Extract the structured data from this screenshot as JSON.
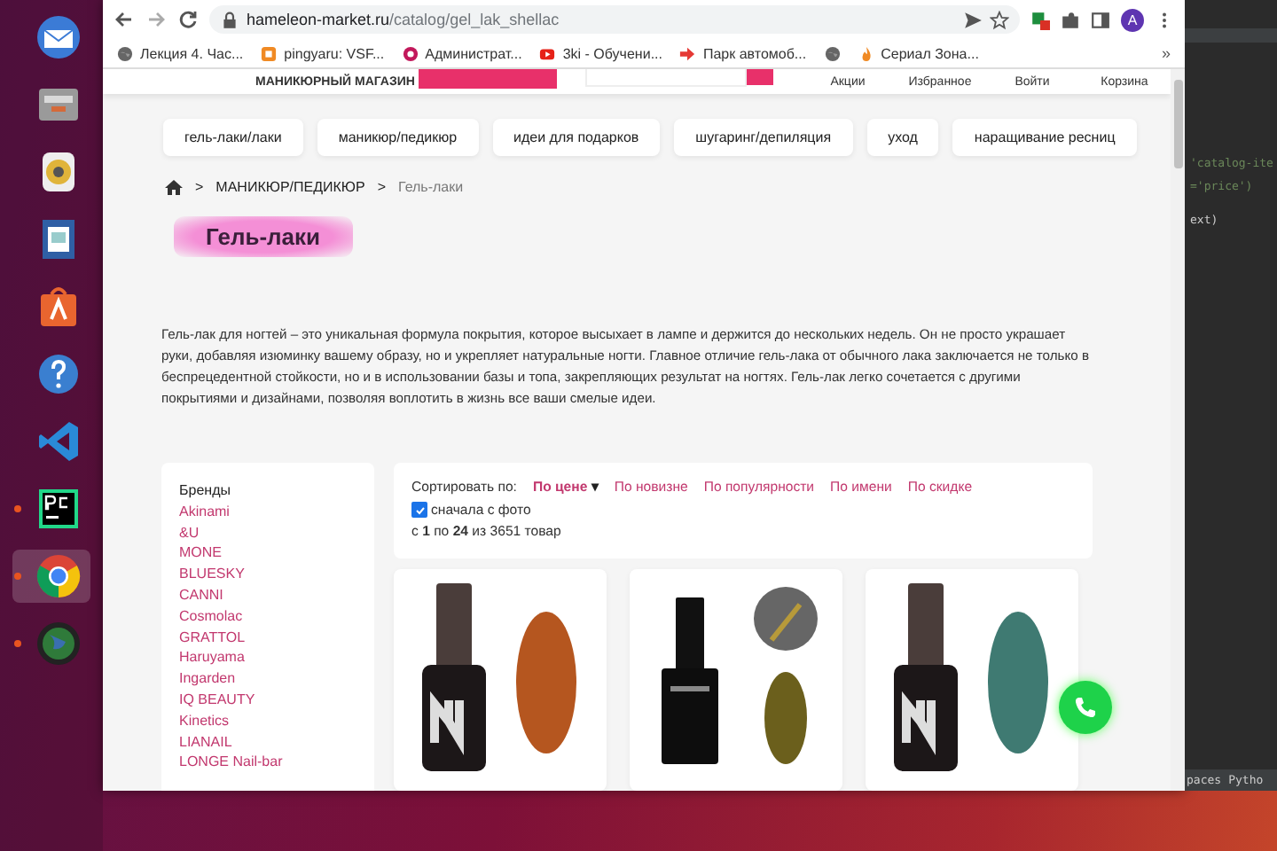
{
  "dock": [
    {
      "kind": "mail",
      "running": false,
      "selected": false
    },
    {
      "kind": "files",
      "running": false,
      "selected": false
    },
    {
      "kind": "music",
      "running": false,
      "selected": false
    },
    {
      "kind": "writer",
      "running": false,
      "selected": false
    },
    {
      "kind": "store",
      "running": false,
      "selected": false
    },
    {
      "kind": "help",
      "running": false,
      "selected": false
    },
    {
      "kind": "code",
      "running": false,
      "selected": false
    },
    {
      "kind": "pycharm",
      "running": true,
      "selected": false
    },
    {
      "kind": "chrome",
      "running": true,
      "selected": true
    },
    {
      "kind": "globe",
      "running": true,
      "selected": false
    }
  ],
  "browser": {
    "url_host": "hameleon-market.ru",
    "url_path": "/catalog/gel_lak_shellac",
    "profile_initial": "A",
    "bookmarks": [
      {
        "kind": "globe",
        "label": "Лекция 4. Час..."
      },
      {
        "kind": "orange",
        "label": "pingyaru: VSF..."
      },
      {
        "kind": "pinkring",
        "label": "Администрат..."
      },
      {
        "kind": "youtube",
        "label": "3ki - Обучени..."
      },
      {
        "kind": "arrow",
        "label": "Парк автомоб..."
      },
      {
        "kind": "globe"
      },
      {
        "kind": "flame",
        "label": "Сериал Зона..."
      }
    ],
    "bookmarks_more": "»"
  },
  "header": {
    "shop_label": "МАНИКЮРНЫЙ МАГАЗИН",
    "links": [
      "Акции",
      "Избранное",
      "Войти",
      "Корзина"
    ]
  },
  "categories": [
    "гель-лаки/лаки",
    "маникюр/педикюр",
    "идеи для подарков",
    "шугаринг/депиляция",
    "уход",
    "наращивание ресниц"
  ],
  "breadcrumb": {
    "separator": ">",
    "items": [
      "МАНИКЮР/ПЕДИКЮР",
      "Гель-лаки"
    ]
  },
  "title": "Гель-лаки",
  "description": "Гель-лак для ногтей – это уникальная формула покрытия, которое высыхает в лампе и держится до нескольких недель. Он не просто украшает руки, добавляя изюминку вашему образу, но и укрепляет натуральные ногти. Главное отличие гель-лака от обычного лака заключается не только в беспрецедентной стойкости, но и в использовании базы и топа, закрепляющих результат на ногтях. Гель-лак легко сочетается с другими покрытиями и дизайнами, позволяя воплотить в жизнь все ваши смелые идеи.",
  "filters": {
    "heading": "Бренды",
    "brands": [
      "Akinami",
      "&U",
      "MONE",
      "BLUESKY",
      "CANNI",
      "Cosmolac",
      "GRATTOL",
      "Haruyama",
      "Ingarden",
      "IQ BEAUTY",
      "Kinetics",
      "LIANAIL",
      "LONGE Nail-bar"
    ]
  },
  "sort": {
    "label": "Сортировать по:",
    "options": [
      {
        "label": "По цене",
        "selected": true,
        "caret": "▾"
      },
      {
        "label": "По новизне",
        "selected": false
      },
      {
        "label": "По популярности",
        "selected": false
      },
      {
        "label": "По имени",
        "selected": false
      },
      {
        "label": "По скидке",
        "selected": false
      }
    ],
    "photo_first": {
      "label": "сначала с фото",
      "checked": true
    },
    "count": "с **1** по **24** из 3651 товар"
  },
  "products": [
    {
      "kind": "logo"
    },
    {
      "kind": "plain"
    },
    {
      "kind": "logo"
    }
  ],
  "editor": {
    "lines": [
      "'catalog-ite",
      "='price')",
      "ext)"
    ],
    "status": [
      "paces",
      "Pytho"
    ]
  }
}
